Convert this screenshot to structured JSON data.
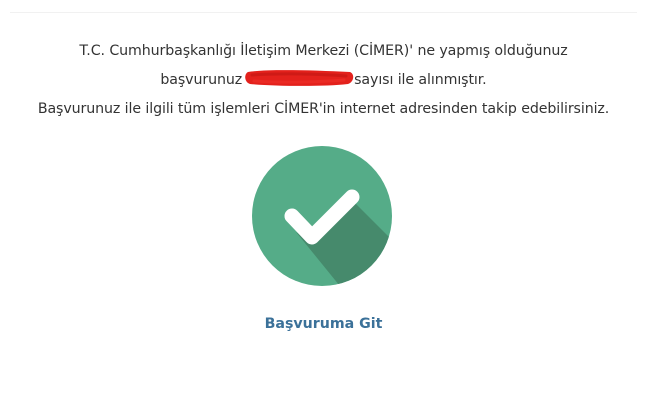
{
  "message": {
    "line1": "T.C. Cumhurbaşkanlığı İletişim Merkezi (CİMER)' ne yapmış olduğunuz",
    "line2_prefix": "başvurunuz",
    "line2_suffix": "sayısı ile alınmıştır.",
    "line3": "Başvurunuz ile ilgili tüm işlemleri CİMER'in internet adresinden takip edebilirsiniz."
  },
  "icons": {
    "success": "check-circle-icon"
  },
  "link": {
    "label": "Başvuruma Git"
  },
  "colors": {
    "badge": "#55ac88",
    "badge_shadow": "#468a6c",
    "check": "#ffffff",
    "link": "#3b7199",
    "redaction": "#e3211c",
    "text": "#333333"
  }
}
